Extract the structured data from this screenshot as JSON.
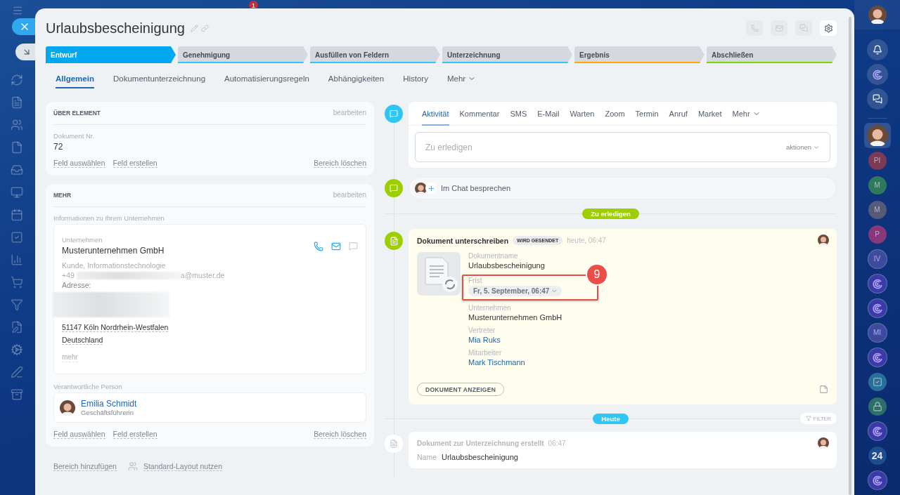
{
  "top_badge": "1",
  "header": {
    "title": "Urlaubsbescheinigung"
  },
  "stages": [
    {
      "label": "Entwurf",
      "selected": true,
      "color": "#00a8ef"
    },
    {
      "label": "Genehmigung",
      "selected": false,
      "color": "#2fc6f6"
    },
    {
      "label": "Ausfüllen von Feldern",
      "selected": false,
      "color": "#2fc6f6"
    },
    {
      "label": "Unterzeichnung",
      "selected": false,
      "color": "#2fc6f6"
    },
    {
      "label": "Ergebnis",
      "selected": false,
      "color": "#ffa900"
    },
    {
      "label": "Abschließen",
      "selected": false,
      "color": "#7bd500"
    }
  ],
  "tabs": [
    {
      "label": "Allgemein",
      "selected": true,
      "kind": "tab"
    },
    {
      "label": "Dokumentunterzeichnung",
      "selected": false,
      "kind": "tab"
    },
    {
      "label": "Automatisierungsregeln",
      "selected": false,
      "kind": "tab"
    },
    {
      "label": "Abhängigkeiten",
      "selected": false,
      "kind": "tab"
    },
    {
      "label": "History",
      "selected": false,
      "kind": "tab"
    },
    {
      "label": "Mehr",
      "selected": false,
      "kind": "menu"
    }
  ],
  "about_section": {
    "title": "ÜBER ELEMENT",
    "edit": "bearbeiten",
    "field_label": "Dokument Nr.",
    "field_value": "72",
    "footer": {
      "links": [
        "Feld auswählen",
        "Feld erstellen"
      ],
      "delete": "Bereich löschen"
    }
  },
  "more_section": {
    "title": "MEHR",
    "edit": "bearbeiten",
    "company_label": "Informationen zu Ihrem Unternehmen",
    "company": {
      "caption": "Unternehmen",
      "name": "Musterunternehmen GmbH",
      "type": "Kunde, Informationstechnologie",
      "phone_prefix": "+49",
      "email_end": "a@muster.de",
      "address_label": "Adresse:",
      "address_lines": [
        "51147 Köln Nordrhein-Westfalen",
        "Deutschland"
      ],
      "more": "mehr"
    },
    "person_label": "Verantwortliche Person",
    "person": {
      "name": "Emilia Schmidt",
      "role": "Geschäftsführerin"
    },
    "footer": {
      "links": [
        "Feld auswählen",
        "Feld erstellen"
      ],
      "delete": "Bereich löschen"
    }
  },
  "layout_actions": {
    "add": "Bereich hinzufügen",
    "default_layout": "Standard-Layout nutzen"
  },
  "activity": {
    "tabs": [
      {
        "label": "Aktivität",
        "selected": true,
        "kind": "tab"
      },
      {
        "label": "Kommentar",
        "selected": false,
        "kind": "tab"
      },
      {
        "label": "SMS",
        "selected": false,
        "kind": "tab"
      },
      {
        "label": "E-Mail",
        "selected": false,
        "kind": "tab"
      },
      {
        "label": "Warten",
        "selected": false,
        "kind": "tab"
      },
      {
        "label": "Zoom",
        "selected": false,
        "kind": "tab"
      },
      {
        "label": "Termin",
        "selected": false,
        "kind": "tab"
      },
      {
        "label": "Anruf",
        "selected": false,
        "kind": "tab"
      },
      {
        "label": "Market",
        "selected": false,
        "kind": "tab"
      },
      {
        "label": "Mehr",
        "selected": false,
        "kind": "menu"
      }
    ],
    "placeholder": "Zu erledigen",
    "actions": "aktionen"
  },
  "chat": {
    "label": "Im Chat besprechen"
  },
  "todo_divider": "Zu erledigen",
  "sign_task": {
    "title": "Dokument unterschreiben",
    "status": "WIRD GESENDET",
    "time": "heute, 06:47",
    "fields": [
      {
        "label": "Dokumentname",
        "value": "Urlaubsbescheinigung",
        "kind": "text"
      },
      {
        "label": "Frist",
        "value": "Fr, 5. September, 06:47",
        "kind": "date"
      },
      {
        "label": "Unternehmen",
        "value": "Musterunternehmen GmbH",
        "kind": "text"
      },
      {
        "label": "Vertreter",
        "value": "Mia Ruks",
        "kind": "link"
      },
      {
        "label": "Mitarbeiter",
        "value": "Mark Tischmann",
        "kind": "link"
      }
    ],
    "button": "DOKUMENT ANZEIGEN",
    "annotation": "9"
  },
  "today_divider": "Heute",
  "filter": "FILTER",
  "history_item": {
    "title": "Dokument zur Unterzeichnung erstellt",
    "time": "06:47",
    "name_label": "Name",
    "name_value": "Urlaubsbescheinigung"
  },
  "right_bar": {
    "chats": [
      {
        "kind": "photo",
        "selected": true
      },
      {
        "kind": "initials",
        "text": "PI",
        "color": "#7c3a55",
        "selected": false
      },
      {
        "kind": "initials",
        "text": "M",
        "color": "#2e7a5c",
        "selected": false
      },
      {
        "kind": "initials",
        "text": "M",
        "color": "#555a78",
        "selected": false
      },
      {
        "kind": "initials",
        "text": "P",
        "color": "#86397a",
        "selected": false
      },
      {
        "kind": "outlined",
        "text": "IV",
        "selected": false
      },
      {
        "kind": "openline",
        "selected": false
      },
      {
        "kind": "openline",
        "selected": false
      },
      {
        "kind": "outlined",
        "text": "MI",
        "selected": false
      },
      {
        "kind": "openline",
        "selected": false
      },
      {
        "kind": "tasks",
        "color": "#2a6f9a",
        "selected": false
      },
      {
        "kind": "locked",
        "color": "#2c6f6a",
        "selected": false
      },
      {
        "kind": "openline",
        "selected": false
      },
      {
        "kind": "brand",
        "text": "24",
        "selected": false
      },
      {
        "kind": "openline",
        "selected": false
      }
    ]
  }
}
